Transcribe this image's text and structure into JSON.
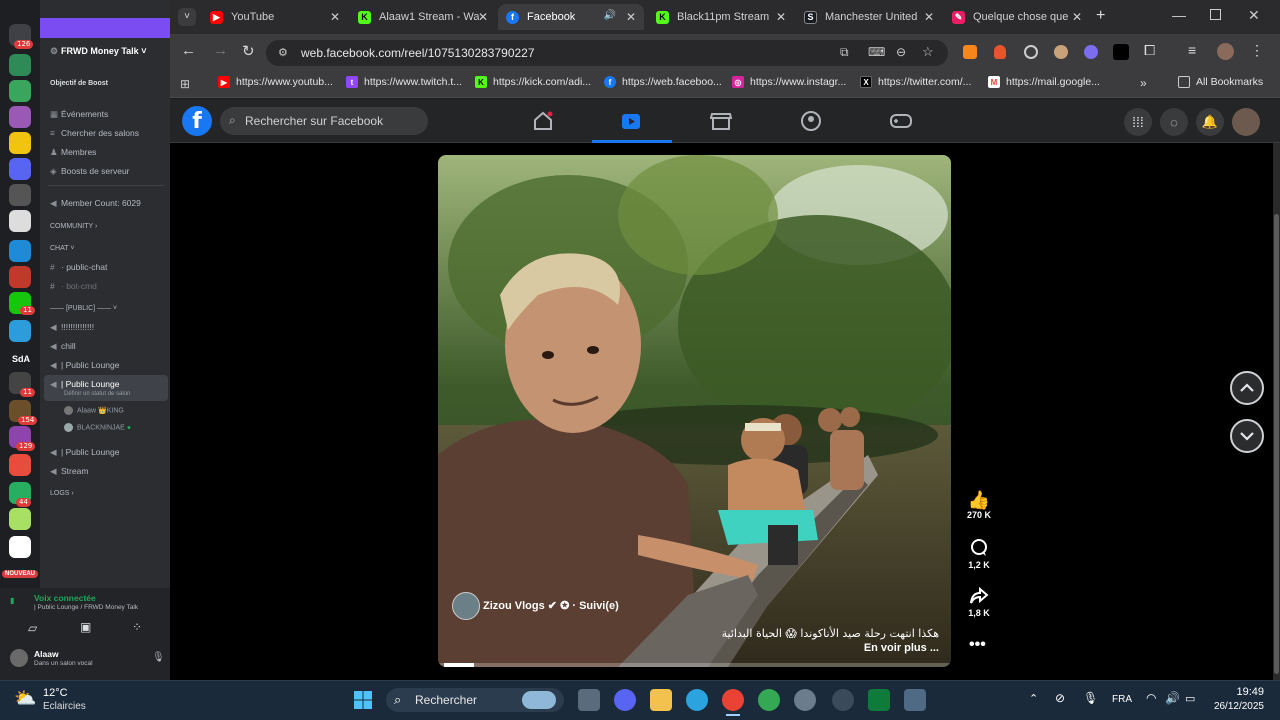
{
  "colors": {
    "discord_accent": "#7a4cf2",
    "facebook_blue": "#1877f2",
    "voice_green": "#23a55a",
    "mention_red": "#e03b3b"
  },
  "discord": {
    "server_name": "FRWD Money Talk",
    "boost_label": "Objectif de Boost",
    "menu": [
      {
        "label": "Événements",
        "icon": "calendar-icon"
      },
      {
        "label": "Chercher des salons",
        "icon": "channels-icon"
      },
      {
        "label": "Membres",
        "icon": "members-icon"
      },
      {
        "label": "Boosts de serveur",
        "icon": "boost-icon"
      }
    ],
    "member_count": "Member Count: 6029",
    "community": "COMMUNITY",
    "chat": "CHAT",
    "public_chat": "public-chat",
    "bot_cmd": "bot-cmd",
    "public_section": "—— [PUBLIC] ——",
    "voice_channels": [
      "!!!!!!!!!!!!!!",
      "chill",
      "| Public Lounge",
      "| Public Lounge"
    ],
    "status_hint": "Définir un statut de salon",
    "users": [
      "Alaaw 👑KING",
      "BLACKNINJAE"
    ],
    "lounge3": "| Public Lounge",
    "stream": "Stream",
    "logs": "LOGS",
    "voice_status": "Voix connectée",
    "voice_location": "| Public Lounge / FRWD Money Talk",
    "username": "Alaaw",
    "user_status": "Dans un salon vocal",
    "badges": [
      "126",
      "11",
      "11",
      "154",
      "129",
      "44"
    ],
    "sda": "SdA",
    "new_label": "NOUVEAU"
  },
  "browser": {
    "tabs": [
      {
        "label": "YouTube",
        "icon": "youtube-icon"
      },
      {
        "label": "Alaaw1 Stream - Wa",
        "icon": "kick-icon"
      },
      {
        "label": "Facebook",
        "icon": "facebook-icon"
      },
      {
        "label": "Black11pm Stream",
        "icon": "kick-icon"
      },
      {
        "label": "Manchester United",
        "icon": "steam-icon"
      },
      {
        "label": "Quelque chose que",
        "icon": "pen-icon"
      }
    ],
    "url": "web.facebook.com/reel/1075130283790227",
    "bookmarks": [
      "https://www.youtub...",
      "https://www.twitch.t...",
      "https://kick.com/adi...",
      "https://web.faceboo...",
      "https://www.instagr...",
      "https://twitter.com/...",
      "https://mail.google..."
    ],
    "all_bookmarks": "All Bookmarks"
  },
  "facebook": {
    "search_placeholder": "Rechercher sur Facebook",
    "reel": {
      "author": "Zizou Vlogs",
      "follow_state": "· Suivi(e)",
      "caption": "هكذا انتهت رحلة صيد الأناكوندا 😱 الحياة البدائية",
      "see_more": "En voir plus ..."
    },
    "likes": "270 K",
    "comments": "1,2 K",
    "shares": "1,8 K"
  },
  "taskbar": {
    "weather_temp": "12°C",
    "weather_desc": "Eclaircies",
    "search_label": "Rechercher",
    "lang": "FRA",
    "time": "19:49",
    "date": "26/12/2025"
  }
}
